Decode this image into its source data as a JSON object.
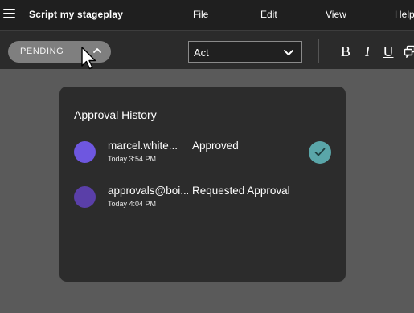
{
  "app": {
    "title": "Script my stageplay"
  },
  "menu": {
    "items": [
      {
        "label": "File"
      },
      {
        "label": "Edit"
      },
      {
        "label": "View"
      },
      {
        "label": "Help"
      }
    ]
  },
  "toolbar": {
    "status_label": "PENDING",
    "act_select_value": "Act",
    "format_buttons": [
      {
        "label": "B",
        "icon": "bold-icon"
      },
      {
        "label": "I",
        "icon": "italic-icon"
      },
      {
        "label": "U",
        "icon": "underline-icon"
      },
      {
        "icon": "comment-icon"
      }
    ]
  },
  "approval_history": {
    "title": "Approval History",
    "entries": [
      {
        "user": "marcel.white...",
        "time": "Today 3:54 PM",
        "action": "Approved",
        "avatar_color": "#6e57e0",
        "approved": true
      },
      {
        "user": "approvals@boi...",
        "time": "Today 4:04 PM",
        "action": "Requested Approval",
        "avatar_color": "#5a3fa8",
        "approved": false
      }
    ]
  },
  "colors": {
    "menubar_bg": "#1f1f1f",
    "toolbar_bg": "#2b2b2b",
    "page_bg": "#5a5a5a",
    "panel_bg": "#2c2c2c",
    "pill_bg": "#7f7f7f",
    "check_bg": "#5aa6a9"
  }
}
